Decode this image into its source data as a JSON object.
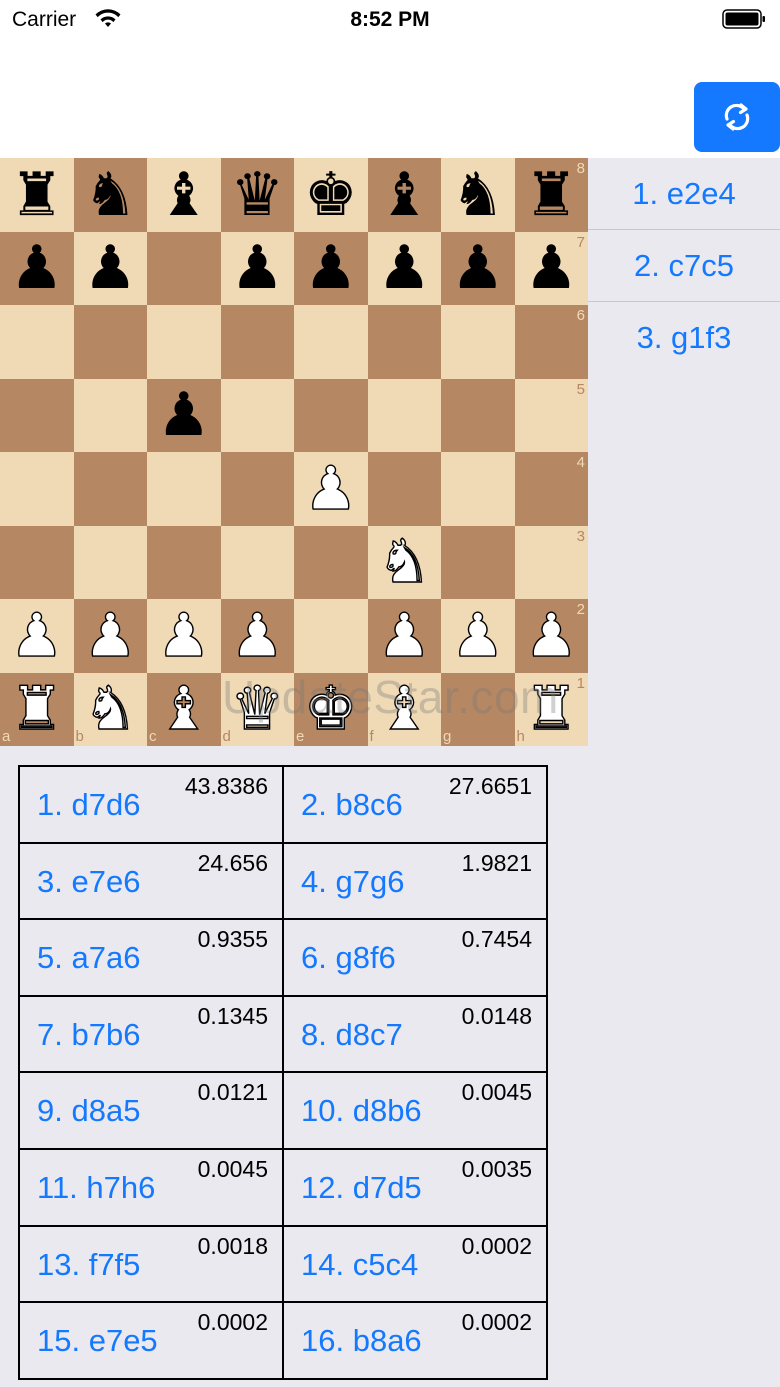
{
  "status": {
    "carrier": "Carrier",
    "time": "8:52 PM"
  },
  "icons": {
    "wifi": "wifi-icon",
    "battery": "battery-icon",
    "flip": "flip-board-icon"
  },
  "colors": {
    "accent": "#1479ff",
    "light_square": "#f0d9b5",
    "dark_square": "#b58863",
    "background": "#e9e9ef"
  },
  "board": {
    "ranks": [
      [
        "br",
        "bn",
        "bb",
        "bq",
        "bk",
        "bb",
        "bn",
        "br"
      ],
      [
        "bp",
        "bp",
        "",
        "bp",
        "bp",
        "bp",
        "bp",
        "bp"
      ],
      [
        "",
        "",
        "",
        "",
        "",
        "",
        "",
        ""
      ],
      [
        "",
        "",
        "bp",
        "",
        "",
        "",
        "",
        ""
      ],
      [
        "",
        "",
        "",
        "",
        "wp",
        "",
        "",
        ""
      ],
      [
        "",
        "",
        "",
        "",
        "",
        "wn",
        "",
        ""
      ],
      [
        "wp",
        "wp",
        "wp",
        "wp",
        "",
        "wp",
        "wp",
        "wp"
      ],
      [
        "wr",
        "wn",
        "wb",
        "wq",
        "wk",
        "wb",
        "",
        "wr"
      ]
    ],
    "rank_labels": [
      "8",
      "7",
      "6",
      "5",
      "4",
      "3",
      "2",
      "1"
    ],
    "file_labels": [
      "a",
      "b",
      "c",
      "d",
      "e",
      "f",
      "g",
      "h"
    ]
  },
  "watermark": "UpdateStar.com",
  "moves": [
    "1. e2e4",
    "2. c7c5",
    "3. g1f3"
  ],
  "suggestions": [
    {
      "move": "1. d7d6",
      "score": "43.8386"
    },
    {
      "move": "2. b8c6",
      "score": "27.6651"
    },
    {
      "move": "3. e7e6",
      "score": "24.656"
    },
    {
      "move": "4. g7g6",
      "score": "1.9821"
    },
    {
      "move": "5. a7a6",
      "score": "0.9355"
    },
    {
      "move": "6. g8f6",
      "score": "0.7454"
    },
    {
      "move": "7. b7b6",
      "score": "0.1345"
    },
    {
      "move": "8. d8c7",
      "score": "0.0148"
    },
    {
      "move": "9. d8a5",
      "score": "0.0121"
    },
    {
      "move": "10. d8b6",
      "score": "0.0045"
    },
    {
      "move": "11. h7h6",
      "score": "0.0045"
    },
    {
      "move": "12. d7d5",
      "score": "0.0035"
    },
    {
      "move": "13. f7f5",
      "score": "0.0018"
    },
    {
      "move": "14. c5c4",
      "score": "0.0002"
    },
    {
      "move": "15. e7e5",
      "score": "0.0002"
    },
    {
      "move": "16. b8a6",
      "score": "0.0002"
    }
  ]
}
